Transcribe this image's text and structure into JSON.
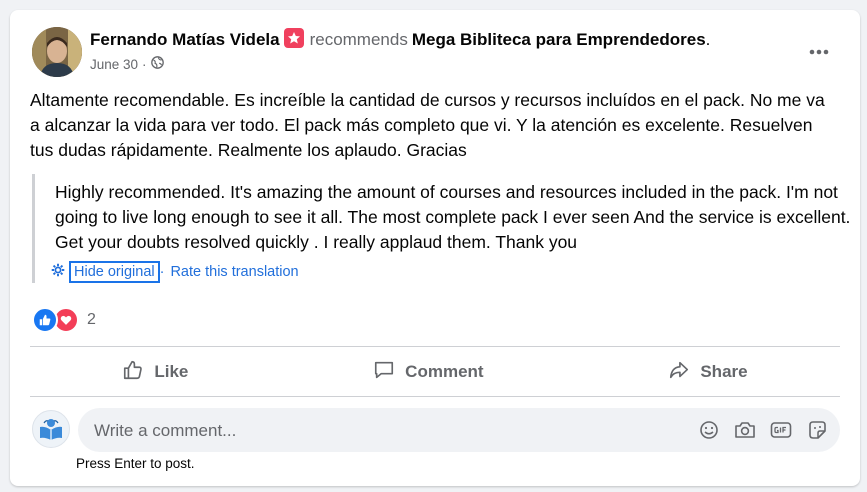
{
  "post": {
    "author": "Fernando Matías Videla",
    "verb": "recommends",
    "page": "Mega Bibliteca para Emprendedores",
    "page_suffix": ".",
    "date": "June 30",
    "separator": "·",
    "text": "Altamente recomendable. Es increíble la cantidad de cursos y recursos incluídos en el pack. No me va a alcanzar la vida para ver todo. El pack más completo que vi. Y la atención es excelente. Resuelven tus dudas rápidamente. Realmente los aplaudo. Gracias",
    "translation": "Highly recommended. It's amazing the amount of courses and resources included in the pack. I'm not going to live long enough to see it all. The most complete pack I ever seen And the service is excellent. Get your doubts resolved quickly . I really applaud them. Thank you",
    "hide_original": "Hide original",
    "link_separator": "·",
    "rate_translation": "Rate this translation"
  },
  "reactions": {
    "count": "2"
  },
  "actions": {
    "like": "Like",
    "comment": "Comment",
    "share": "Share"
  },
  "comment": {
    "placeholder": "Write a comment...",
    "hint": "Press Enter to post."
  },
  "colors": {
    "accent": "#1877f2",
    "love": "#f33e58",
    "badge": "#f0405e",
    "link": "#216fdb"
  },
  "icons": [
    "star-badge-icon",
    "globe-icon",
    "more-icon",
    "settings-icon",
    "like-reaction-icon",
    "love-reaction-icon",
    "like-icon",
    "comment-icon",
    "share-icon",
    "emoji-icon",
    "camera-icon",
    "gif-icon",
    "sticker-icon"
  ]
}
